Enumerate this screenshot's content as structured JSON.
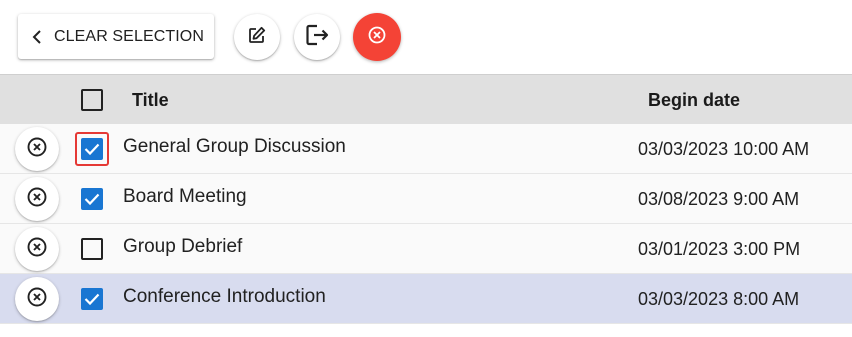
{
  "toolbar": {
    "clear_selection_label": "CLEAR SELECTION",
    "edit_icon": "edit-icon",
    "export_icon": "export-icon",
    "delete_icon": "close-circle-icon",
    "accent_red": "#f44336"
  },
  "table": {
    "columns": {
      "title": "Title",
      "begin_date": "Begin date"
    },
    "rows": [
      {
        "title": "General Group Discussion",
        "begin_date": "03/03/2023 10:00 AM",
        "checked": true,
        "focused": true,
        "highlighted": false
      },
      {
        "title": "Board Meeting",
        "begin_date": "03/08/2023 9:00 AM",
        "checked": true,
        "focused": false,
        "highlighted": false
      },
      {
        "title": "Group Debrief",
        "begin_date": "03/01/2023 3:00 PM",
        "checked": false,
        "focused": false,
        "highlighted": false
      },
      {
        "title": "Conference Introduction",
        "begin_date": "03/03/2023 8:00 AM",
        "checked": true,
        "focused": false,
        "highlighted": true
      }
    ],
    "checkbox_color": "#1976d2",
    "highlight_color": "#d8dcef"
  }
}
